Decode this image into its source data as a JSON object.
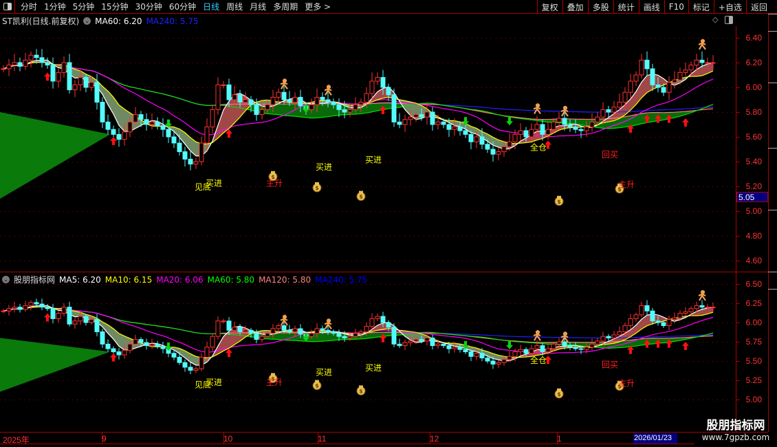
{
  "toolbar": {
    "periods": [
      "分时",
      "1分钟",
      "5分钟",
      "15分钟",
      "30分钟",
      "60分钟",
      "日线",
      "周线",
      "月线",
      "多周期",
      "更多 >"
    ],
    "active_period": "日线",
    "buttons": [
      "复权",
      "叠加",
      "多股",
      "统计",
      "画线",
      "F10",
      "标记",
      "+自选",
      "返回"
    ]
  },
  "upper": {
    "title": "ST凯利(日线.前复权)",
    "ma60": "MA60: 6.20",
    "ma240": "MA240: 5.75",
    "axis": [
      "6.40",
      "6.20",
      "6.00",
      "5.80",
      "5.60",
      "5.40",
      "5.20",
      "5.00",
      "4.80",
      "4.60"
    ],
    "current_price": "5.05"
  },
  "lower": {
    "title": "股朋指标网",
    "legend": [
      {
        "text": "MA5: 6.20",
        "color": "#ffffff"
      },
      {
        "text": "MA10: 6.15",
        "color": "#ffff00"
      },
      {
        "text": "MA20: 6.06",
        "color": "#ff00ff"
      },
      {
        "text": "MA60: 5.80",
        "color": "#00ff00"
      },
      {
        "text": "MA120: 5.80",
        "color": "#ff8080"
      },
      {
        "text": "MA240: 5.75",
        "color": "#0000ff"
      }
    ],
    "axis": [
      "6.50",
      "6.25",
      "6.00",
      "5.75",
      "5.50",
      "5.25",
      "5.00"
    ]
  },
  "time_axis": {
    "labels": [
      "2025年",
      "9",
      "10",
      "11",
      "12",
      "1"
    ],
    "cursor_date": "2026/01/23"
  },
  "watermark": {
    "name": "股朋指标网",
    "url": "www.7gpzb.com"
  },
  "colors": {
    "up": "#ff3232",
    "down": "#54fcfc",
    "ma5": "#ffffff",
    "ma10": "#ffff00",
    "ma20": "#ff00ff",
    "ma60": "#00e000",
    "ma120": "#ff8080",
    "ma240": "#2020ff",
    "grid": "#b00000"
  },
  "chart_data": {
    "type": "candlestick",
    "ylim_upper": [
      4.6,
      6.4
    ],
    "ylim_lower": [
      5.0,
      6.5
    ],
    "close": [
      6.15,
      6.18,
      6.2,
      6.17,
      6.22,
      6.26,
      6.24,
      6.2,
      6.18,
      6.05,
      6.12,
      6.2,
      5.98,
      6.02,
      6.08,
      6.0,
      6.04,
      5.88,
      5.72,
      5.66,
      5.62,
      5.58,
      5.64,
      5.72,
      5.78,
      5.74,
      5.7,
      5.72,
      5.69,
      5.66,
      5.6,
      5.55,
      5.48,
      5.42,
      5.38,
      5.4,
      5.55,
      5.68,
      5.82,
      6.02,
      6.02,
      5.9,
      5.94,
      5.88,
      5.9,
      5.86,
      5.78,
      5.82,
      5.86,
      5.92,
      5.96,
      5.9,
      5.88,
      5.92,
      5.85,
      5.82,
      5.86,
      5.92,
      5.9,
      5.88,
      5.86,
      5.82,
      5.8,
      5.82,
      5.86,
      5.88,
      5.95,
      6.05,
      6.08,
      6.0,
      5.94,
      5.72,
      5.7,
      5.74,
      5.76,
      5.78,
      5.76,
      5.8,
      5.7,
      5.72,
      5.7,
      5.66,
      5.68,
      5.65,
      5.62,
      5.56,
      5.6,
      5.54,
      5.5,
      5.46,
      5.48,
      5.52,
      5.56,
      5.62,
      5.65,
      5.6,
      5.66,
      5.7,
      5.62,
      5.66,
      5.72,
      5.75,
      5.7,
      5.68,
      5.66,
      5.65,
      5.68,
      5.72,
      5.76,
      5.82,
      5.8,
      5.84,
      5.88,
      5.96,
      6.05,
      6.1,
      6.22,
      6.15,
      6.02,
      6.0,
      5.96,
      6.04,
      6.06,
      6.12,
      6.14,
      6.18,
      6.22,
      6.2,
      6.2,
      6.2
    ],
    "signals": [
      {
        "text": "见底",
        "i": 36,
        "price": 5.2,
        "color": "#ffff00"
      },
      {
        "text": "买进",
        "i": 38,
        "price": 5.23,
        "color": "#ffff00"
      },
      {
        "text": "主升",
        "i": 49,
        "price": 5.23,
        "color": "#ff2020"
      },
      {
        "text": "买进",
        "i": 58,
        "price": 5.36,
        "color": "#ffff00"
      },
      {
        "text": "买进",
        "i": 67,
        "price": 5.42,
        "color": "#ffff00"
      },
      {
        "text": "全仓",
        "i": 97,
        "price": 5.52,
        "color": "#ffff00"
      },
      {
        "text": "回买",
        "i": 110,
        "price": 5.46,
        "color": "#ff2020"
      },
      {
        "text": "主升",
        "i": 113,
        "price": 5.22,
        "color": "#ff2020"
      }
    ],
    "money_bags": [
      {
        "i": 49,
        "price": 5.29
      },
      {
        "i": 57,
        "price": 5.2
      },
      {
        "i": 65,
        "price": 5.13
      },
      {
        "i": 101,
        "price": 5.09
      },
      {
        "i": 112,
        "price": 5.19
      }
    ],
    "runners": [
      {
        "i": 51,
        "price": 6.02
      },
      {
        "i": 59,
        "price": 5.97
      },
      {
        "i": 97,
        "price": 5.82
      },
      {
        "i": 102,
        "price": 5.8
      },
      {
        "i": 127,
        "price": 6.34
      }
    ],
    "up_arrows": [
      {
        "i": 8,
        "price": 6.12
      },
      {
        "i": 20,
        "price": 5.6
      },
      {
        "i": 41,
        "price": 5.66
      },
      {
        "i": 69,
        "price": 5.85
      },
      {
        "i": 99,
        "price": 5.57
      },
      {
        "i": 114,
        "price": 5.7
      },
      {
        "i": 117,
        "price": 5.78
      },
      {
        "i": 119,
        "price": 5.78
      },
      {
        "i": 121,
        "price": 5.78
      },
      {
        "i": 124,
        "price": 5.75
      }
    ],
    "down_arrows": [
      {
        "i": 30,
        "price": 5.74
      },
      {
        "i": 55,
        "price": 5.86
      },
      {
        "i": 84,
        "price": 5.76
      },
      {
        "i": 92,
        "price": 5.76
      }
    ]
  }
}
